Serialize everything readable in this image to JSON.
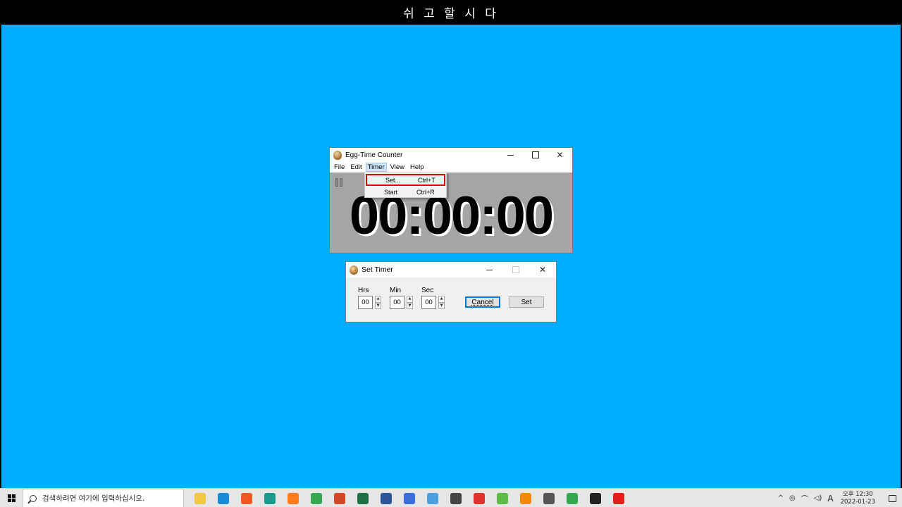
{
  "top_caption": "쉬 고 할 시 다",
  "main_window": {
    "title": "Egg-Time Counter",
    "menu": [
      "File",
      "Edit",
      "Timer",
      "View",
      "Help"
    ],
    "active_menu_index": 2,
    "time_display": "00:00:00"
  },
  "timer_menu": {
    "items": [
      {
        "label": "Set...",
        "shortcut": "Ctrl+T"
      },
      {
        "label": "Start",
        "shortcut": "Ctrl+R"
      }
    ]
  },
  "set_dialog": {
    "title": "Set Timer",
    "hrs_label": "Hrs",
    "min_label": "Min",
    "sec_label": "Sec",
    "hrs_value": "00",
    "min_value": "00",
    "sec_value": "00",
    "cancel_label": "Cancel",
    "set_label": "Set"
  },
  "taskbar": {
    "search_placeholder": "검색하려면 여기에 입력하십시오.",
    "apps": [
      {
        "name": "file-explorer-icon",
        "color": "#f2c744"
      },
      {
        "name": "edge-icon",
        "color": "#1a8ad8"
      },
      {
        "name": "brave-icon",
        "color": "#f05a22"
      },
      {
        "name": "app-teal-icon",
        "color": "#1b9a8e"
      },
      {
        "name": "firefox-icon",
        "color": "#ff7b1c"
      },
      {
        "name": "chrome-icon",
        "color": "#34a853"
      },
      {
        "name": "powerpoint-icon",
        "color": "#d24726"
      },
      {
        "name": "excel-icon",
        "color": "#1e7145"
      },
      {
        "name": "word-icon",
        "color": "#2b579a"
      },
      {
        "name": "notepad-icon",
        "color": "#3a6fd8"
      },
      {
        "name": "app-blue-icon",
        "color": "#4a9fe0"
      },
      {
        "name": "search-app-icon",
        "color": "#444444"
      },
      {
        "name": "app-red-icon",
        "color": "#e0322d"
      },
      {
        "name": "app-green-icon",
        "color": "#5dbb46"
      },
      {
        "name": "vlc-icon",
        "color": "#f08a00"
      },
      {
        "name": "calculator-icon",
        "color": "#555555"
      },
      {
        "name": "chrome-alt-icon",
        "color": "#34a853"
      },
      {
        "name": "sticky-notes-icon",
        "color": "#222222"
      },
      {
        "name": "opera-icon",
        "color": "#e0201b"
      }
    ],
    "ime_indicator": "A",
    "time": "오후 12:30",
    "date": "2022-01-23"
  }
}
